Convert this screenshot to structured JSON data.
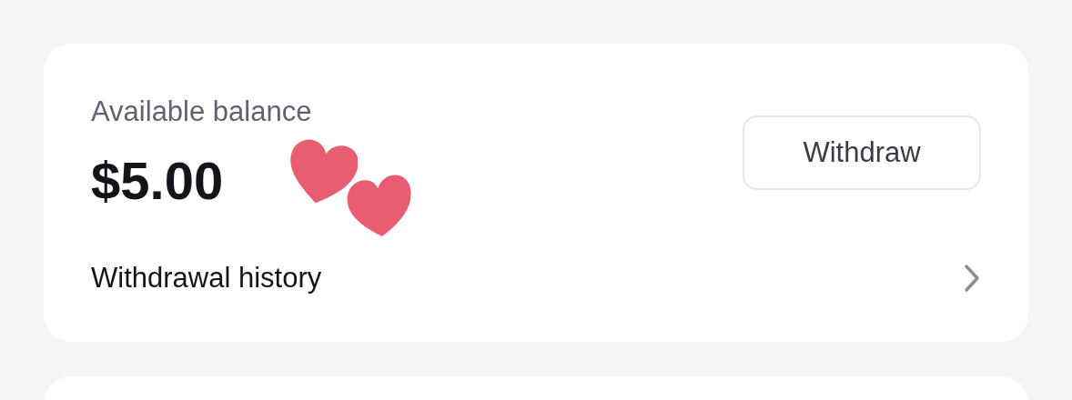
{
  "balance": {
    "label": "Available balance",
    "amount": "$5.00"
  },
  "withdraw_button": {
    "label": "Withdraw"
  },
  "history_link": {
    "label": "Withdrawal history"
  }
}
